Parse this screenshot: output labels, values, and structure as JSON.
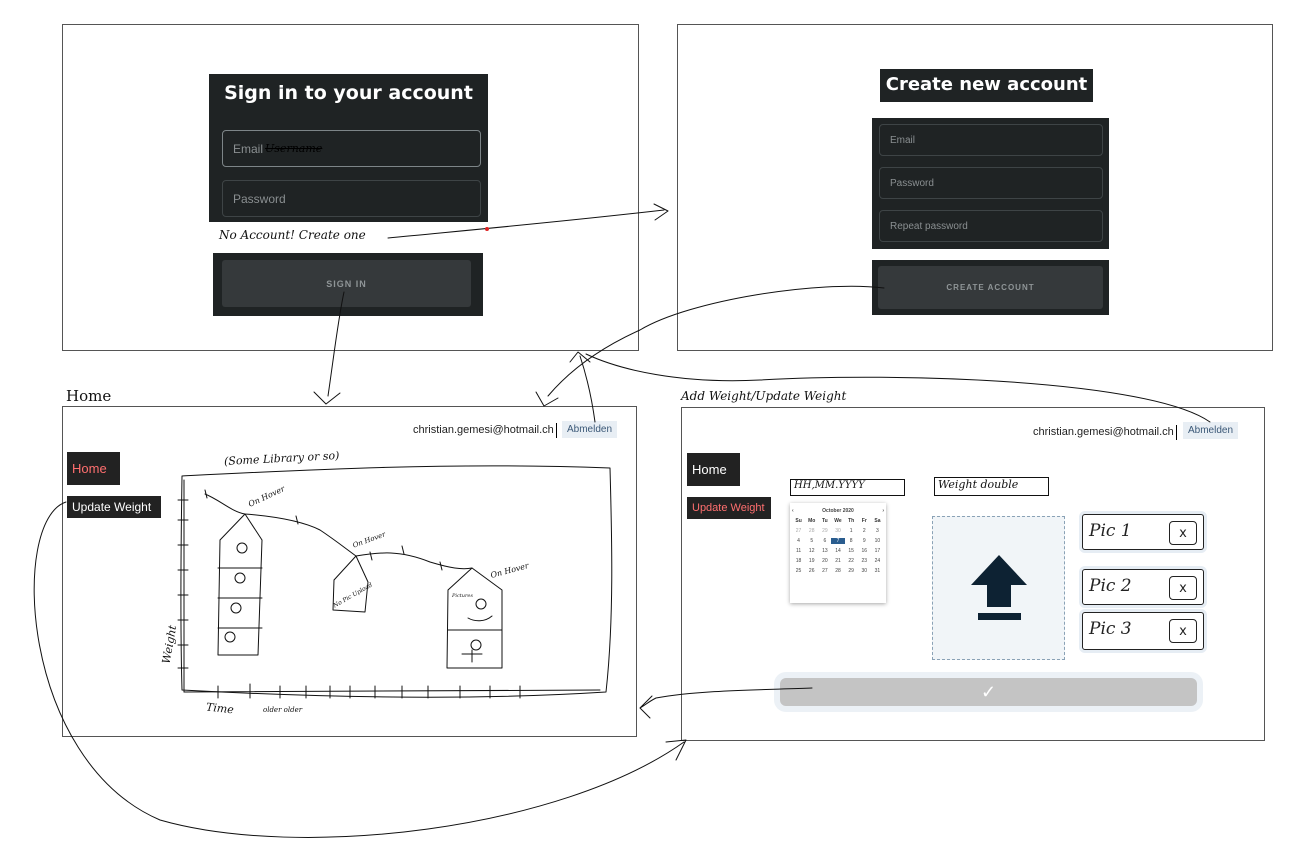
{
  "signin": {
    "title": "Sign in to your account",
    "email_placeholder": "Email",
    "email_scribble": "Username",
    "password_placeholder": "Password",
    "no_account_note": "No Account! Create one",
    "button": "SIGN IN"
  },
  "create": {
    "title": "Create new account",
    "email_placeholder": "Email",
    "password_placeholder": "Password",
    "repeat_placeholder": "Repeat password",
    "button": "CREATE ACCOUNT"
  },
  "home": {
    "frame_label": "Home",
    "user_email": "christian.gemesi@hotmail.ch",
    "logout": "Abmelden",
    "nav_home": "Home",
    "nav_update": "Update Weight",
    "sketch": {
      "library_note": "(Some Library or so)",
      "y_label": "Weight",
      "x_label": "Time",
      "x_note": "older older",
      "hover_1": "On Hover",
      "hover_2": "On Hover",
      "hover_3": "On Hover",
      "pics_note": "No Pic Upload",
      "pics_tag": "Pictures"
    }
  },
  "update": {
    "frame_label": "Add Weight/Update Weight",
    "user_email": "christian.gemesi@hotmail.ch",
    "logout": "Abmelden",
    "nav_home": "Home",
    "nav_update": "Update Weight",
    "date_field": "HH,MM.YYYY",
    "weight_field": "Weight double",
    "calendar": {
      "month": "October 2020",
      "prev": "‹",
      "next": "›",
      "days": [
        "Su",
        "Mo",
        "Tu",
        "We",
        "Th",
        "Fr",
        "Sa"
      ],
      "weeks": [
        [
          "27",
          "28",
          "29",
          "30",
          "1",
          "2",
          "3"
        ],
        [
          "4",
          "5",
          "6",
          "7",
          "8",
          "9",
          "10"
        ],
        [
          "11",
          "12",
          "13",
          "14",
          "15",
          "16",
          "17"
        ],
        [
          "18",
          "19",
          "20",
          "21",
          "22",
          "23",
          "24"
        ],
        [
          "25",
          "26",
          "27",
          "28",
          "29",
          "30",
          "31"
        ]
      ],
      "selected": "7"
    },
    "pics": [
      {
        "label": "Pic 1",
        "remove": "x"
      },
      {
        "label": "Pic 2",
        "remove": "x"
      },
      {
        "label": "Pic 3",
        "remove": "x"
      }
    ],
    "submit_icon": "checkmark-icon"
  },
  "colors": {
    "dark_panel": "#1f2324",
    "nav_accent": "#ff6f6f",
    "upload_arrow": "#0d2233",
    "selected_day": "#2a5d8f"
  }
}
